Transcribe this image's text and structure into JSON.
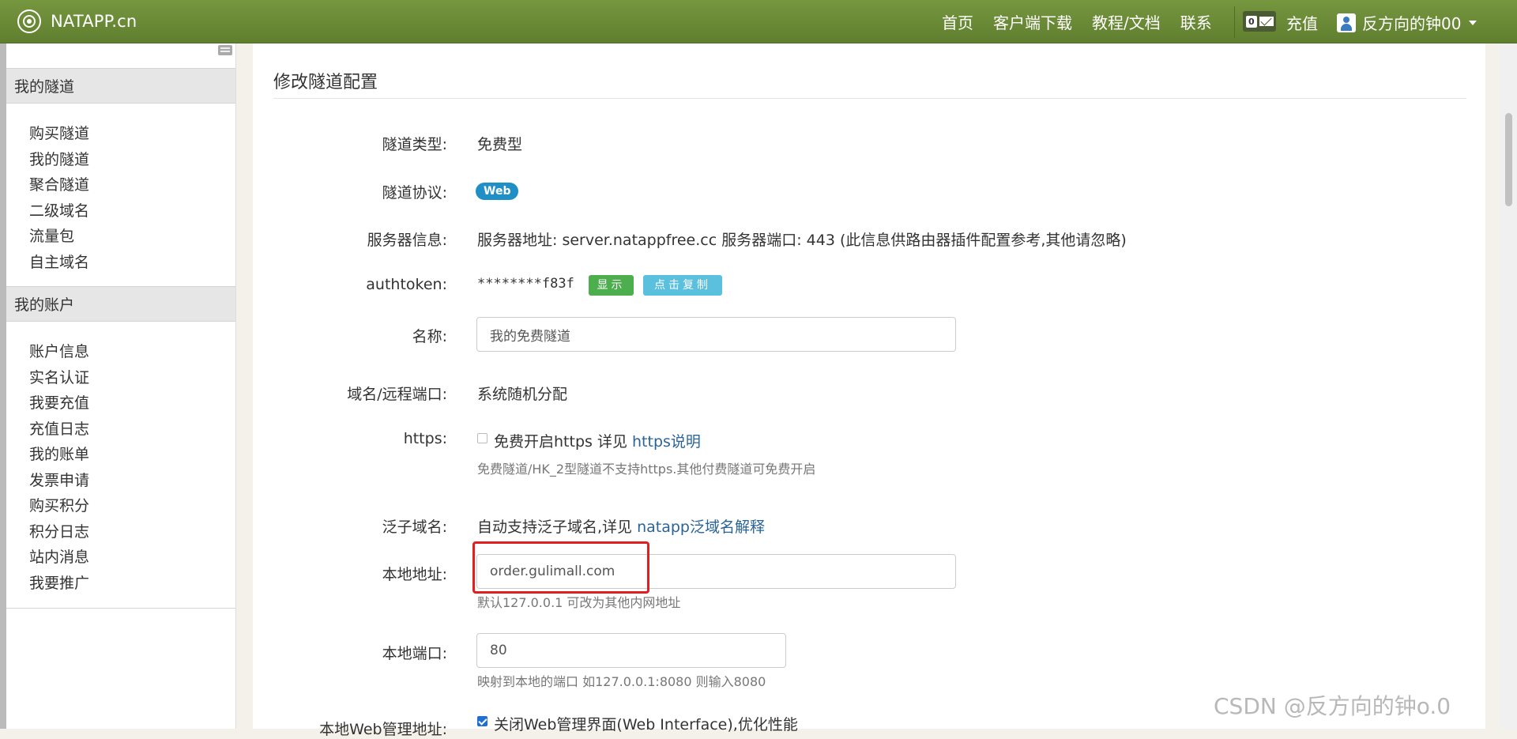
{
  "navbar": {
    "brand": "NATAPP.cn",
    "links": [
      "首页",
      "客户端下载",
      "教程/文档",
      "联系"
    ],
    "mail_count": "0",
    "recharge": "充值",
    "username": "反方向的钟00"
  },
  "sidebar": {
    "section1_title": "我的隧道",
    "section1_items": [
      "购买隧道",
      "我的隧道",
      "聚合隧道",
      "二级域名",
      "流量包",
      "自主域名"
    ],
    "section2_title": "我的账户",
    "section2_items": [
      "账户信息",
      "实名认证",
      "我要充值",
      "充值日志",
      "我的账单",
      "发票申请",
      "购买积分",
      "积分日志",
      "站内消息",
      "我要推广"
    ]
  },
  "form": {
    "page_title": "修改隧道配置",
    "tunnel_type_label": "隧道类型:",
    "tunnel_type_value": "免费型",
    "protocol_label": "隧道协议:",
    "protocol_badge": "Web",
    "server_label": "服务器信息:",
    "server_value": "服务器地址: server.natappfree.cc 服务器端口: 443 (此信息供路由器插件配置参考,其他请忽略)",
    "authtoken_label": "authtoken:",
    "authtoken_value": "********f83f",
    "show_button": "显示",
    "copy_button": "点击复制",
    "name_label": "名称:",
    "name_value": "我的免费隧道",
    "domain_label": "域名/远程端口:",
    "domain_value": "系统随机分配",
    "https_label": "https:",
    "https_checkbox_text": "免费开启https 详见",
    "https_link": "https说明",
    "https_hint": "免费隧道/HK_2型隧道不支持https.其他付费隧道可免费开启",
    "wildcard_label": "泛子域名:",
    "wildcard_text": "自动支持泛子域名,详见",
    "wildcard_link": "natapp泛域名解释",
    "local_addr_label": "本地地址:",
    "local_addr_value": "order.gulimall.com",
    "local_addr_hint": "默认127.0.0.1 可改为其他内网地址",
    "local_port_label": "本地端口:",
    "local_port_value": "80",
    "local_port_hint": "映射到本地的端口 如127.0.0.1:8080 则输入8080",
    "web_mgmt_label": "本地Web管理地址:",
    "web_mgmt_checkbox_text": "关闭Web管理界面(Web Interface),优化性能"
  },
  "watermark": "CSDN @反方向的钟o.0",
  "colors": {
    "navbar": "#6b8a37",
    "badge_web": "#1f8fc6",
    "btn_show": "#4cae4c",
    "btn_copy": "#5bc0de",
    "highlight": "#e02020",
    "link": "#2a6496"
  }
}
